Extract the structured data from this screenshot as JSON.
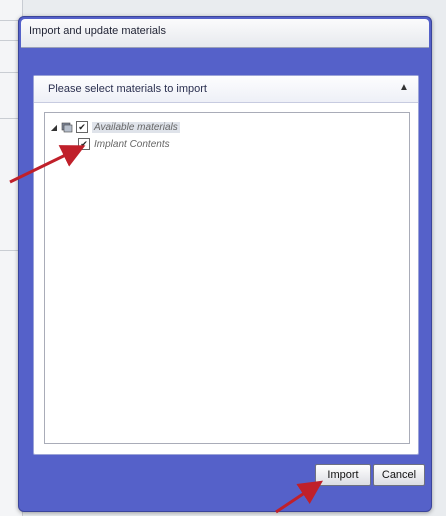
{
  "dialog": {
    "title": "Import and update materials",
    "group_title": "Please select materials to import",
    "collapse_glyph": "▲",
    "tree": [
      {
        "label": "Available materials",
        "checked": true,
        "expanded": true,
        "level": 0
      },
      {
        "label": "Implant Contents",
        "checked": true,
        "level": 1
      }
    ],
    "buttons": {
      "import": "Import",
      "cancel": "Cancel"
    }
  },
  "colors": {
    "dialog_frame": "#5561c9",
    "annotation_arrow": "#c0202a"
  }
}
